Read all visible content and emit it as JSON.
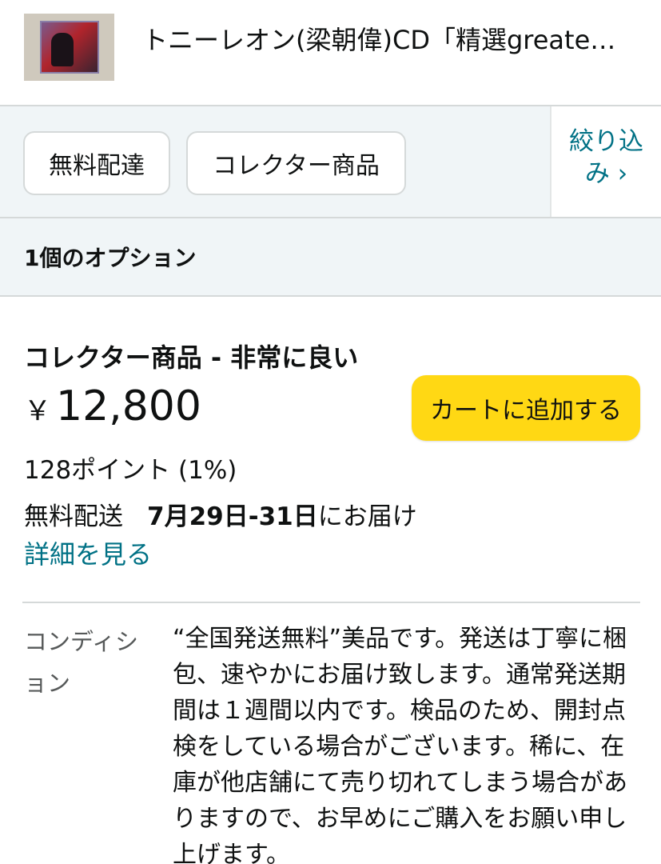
{
  "header": {
    "thumbnail_icon": "cd-cover-thumbnail",
    "title": "トニーレオン(梁朝偉)CD「精選greate…"
  },
  "filters": {
    "chips": [
      "無料配達",
      "コレクター商品"
    ],
    "narrow_line1": "絞り込",
    "narrow_line2": "み ›"
  },
  "options": {
    "count_label": "1個のオプション"
  },
  "offer": {
    "condition_title": "コレクター商品 - 非常に良い",
    "currency": "￥",
    "price": "12,800",
    "add_to_cart": "カートに追加する",
    "points": "128ポイント (1%)",
    "shipping_label": "無料配送",
    "delivery_date": "7月29日-31日",
    "delivery_suffix": "にお届け",
    "details_link": "詳細を見る"
  },
  "condition": {
    "label": "コンディション",
    "text": "“全国発送無料”美品です。発送は丁寧に梱包、速やかにお届け致します。通常発送期間は１週間以内です。検品のため、開封点検をしている場合がございます。稀に、在庫が他店舗にて売り切れてしまう場合がありますので、お早めにご購入をお願い申し上げます。"
  },
  "colors": {
    "accent_link": "#007185",
    "cart_button": "#ffd814",
    "filter_background": "#f0f5f7"
  }
}
